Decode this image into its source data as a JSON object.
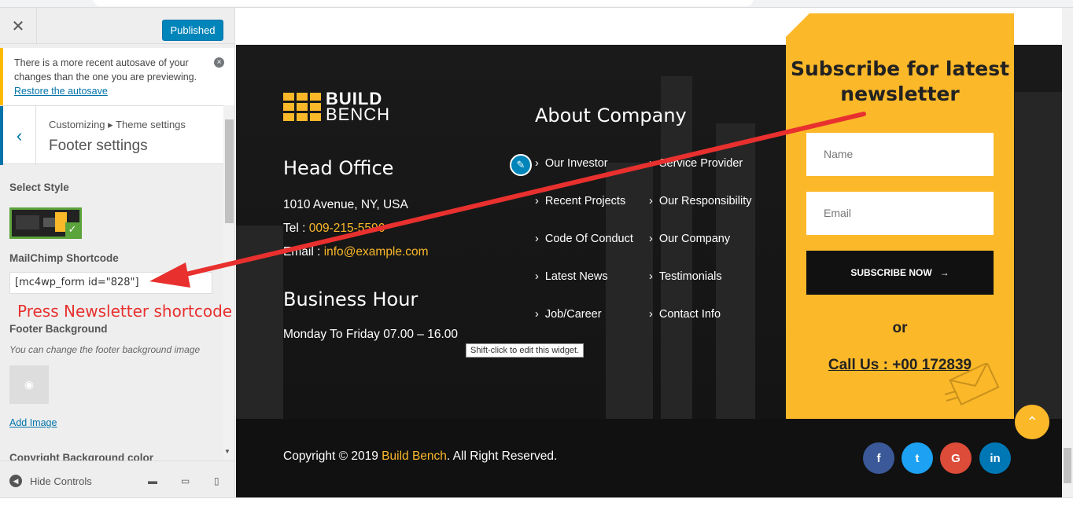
{
  "panel": {
    "publish_label": "Published",
    "autosave": {
      "message": "There is a more recent autosave of your changes than the one you are previewing.",
      "restore_link": "Restore the autosave"
    },
    "breadcrumb": "Customizing ▸ Theme settings",
    "section_title": "Footer settings",
    "select_style_label": "Select Style",
    "mailchimp_label": "MailChimp Shortcode",
    "mailchimp_value": "[mc4wp_form id=\"828\"]",
    "footer_bg_label": "Footer Background",
    "footer_bg_desc": "You can change the footer background image",
    "add_image": "Add Image",
    "copyright_bg_label": "Copyright Background color",
    "hide_controls": "Hide Controls"
  },
  "annotation": {
    "note": "Press Newsletter shortcode",
    "color": "#e8302e"
  },
  "footer": {
    "logo_line1": "BUILD",
    "logo_line2": "BENCH",
    "head_office": "Head Office",
    "address": "1010 Avenue, NY, USA",
    "tel_label": "Tel :",
    "tel_value": "009-215-5596",
    "email_label": "Email :",
    "email_value": "info@example.com",
    "business_hour": "Business Hour",
    "hours": "Monday To Friday 07.00 – 16.00",
    "about_title": "About Company",
    "links_col1": [
      "Our Investor",
      "Recent Projects",
      "Code Of Conduct",
      "Latest News",
      "Job/Career"
    ],
    "links_col2": [
      "Service Provider",
      "Our Responsibility",
      "Our Company",
      "Testimonials",
      "Contact Info"
    ],
    "tooltip": "Shift-click to edit this widget."
  },
  "subscribe": {
    "title": "Subscribe for latest newsletter",
    "name_placeholder": "Name",
    "email_placeholder": "Email",
    "button": "SUBSCRIBE NOW",
    "or": "or",
    "call": "Call Us : +00 172839"
  },
  "copyright": {
    "prefix": "Copyright © 2019",
    "brand": "Build Bench",
    "suffix": ". All Right Reserved."
  },
  "social": [
    "f",
    "t",
    "G",
    "in"
  ],
  "colors": {
    "accent": "#fbb829",
    "dark": "#141414",
    "wp_blue": "#0085ba",
    "facebook": "#3b5998",
    "twitter": "#1da1f2",
    "google": "#dd4b39",
    "linkedin": "#0077b5"
  }
}
